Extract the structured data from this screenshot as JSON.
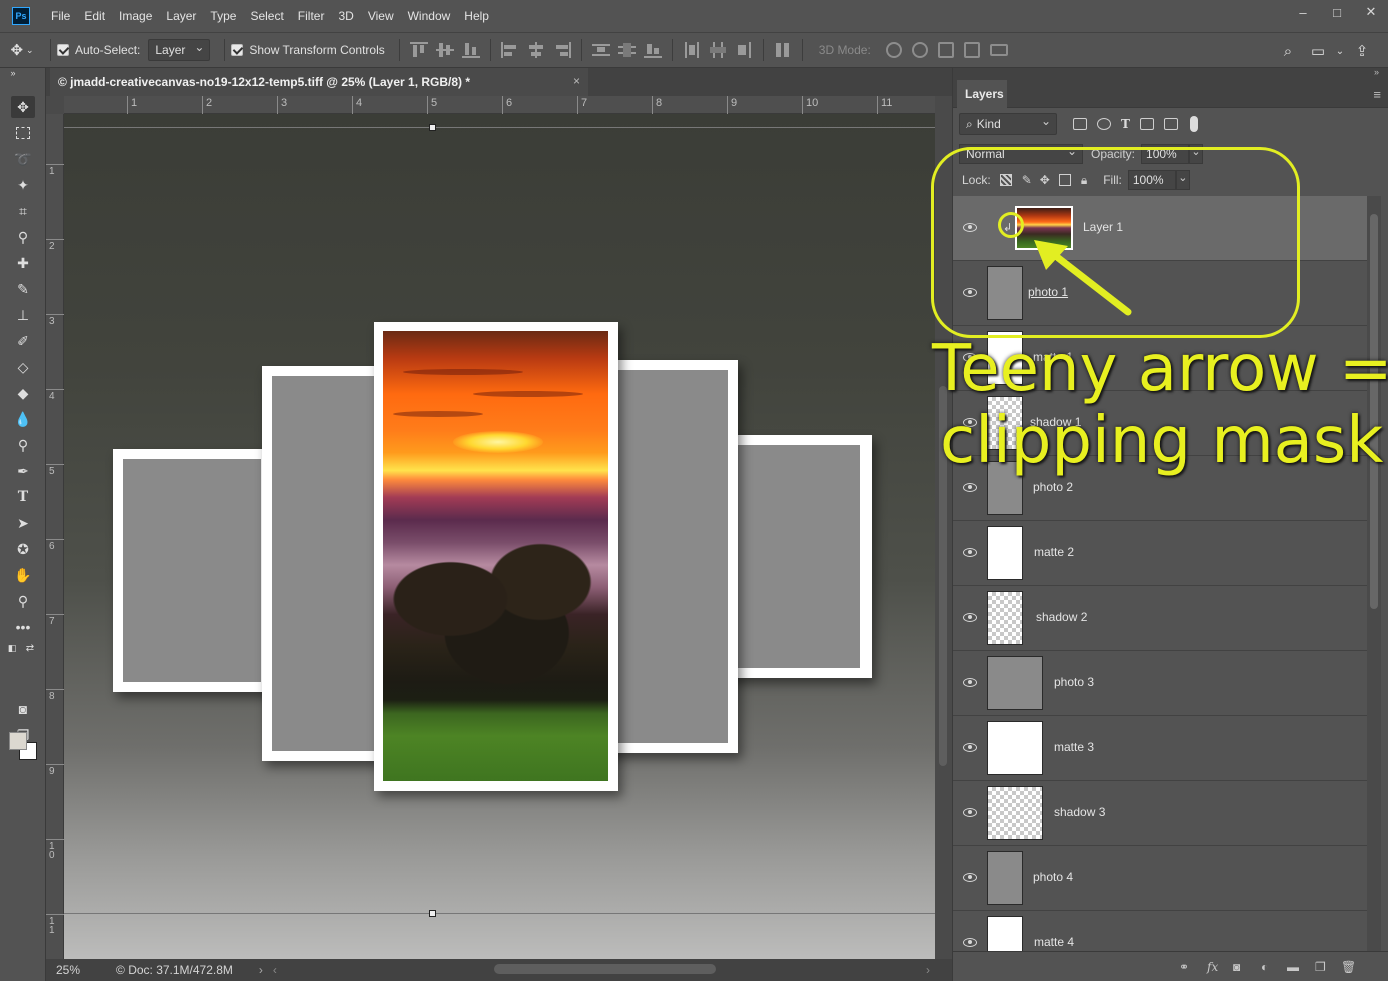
{
  "app": {
    "logo": "Ps"
  },
  "menu": [
    "File",
    "Edit",
    "Image",
    "Layer",
    "Type",
    "Select",
    "Filter",
    "3D",
    "View",
    "Window",
    "Help"
  ],
  "window_controls": {
    "minimize": "–",
    "maximize": "□",
    "close": "✕"
  },
  "options": {
    "auto_select_label": "Auto-Select:",
    "auto_select_value": "Layer",
    "show_transform_label": "Show Transform Controls",
    "mode_label": "3D Mode:"
  },
  "document": {
    "tab_title": "© jmadd-creativecanvas-no19-12x12-temp5.tiff @ 25% (Layer 1, RGB/8) *",
    "close": "×",
    "zoom": "25%",
    "doc_info": "Doc: 37.1M/472.8M"
  },
  "rulers": {
    "h": [
      "1",
      "2",
      "3",
      "4",
      "5",
      "6",
      "7",
      "8",
      "9",
      "10",
      "11"
    ],
    "v": [
      "1",
      "2",
      "3",
      "4",
      "5",
      "6",
      "7",
      "8",
      "9",
      "10",
      "11"
    ]
  },
  "layers_panel": {
    "tab": "Layers",
    "kind": "Kind",
    "blend_mode": "Normal",
    "opacity_label": "Opacity:",
    "opacity_value": "100%",
    "lock_label": "Lock:",
    "fill_label": "Fill:",
    "fill_value": "100%",
    "layers": [
      {
        "name": "Layer 1",
        "thumb": "sunset",
        "selected": true,
        "clipped": true
      },
      {
        "name": "photo 1",
        "thumb": "gray",
        "underline": true
      },
      {
        "name": "matte 1",
        "thumb": "white"
      },
      {
        "name": "shadow 1",
        "thumb": "checker"
      },
      {
        "name": "photo 2",
        "thumb": "gray"
      },
      {
        "name": "matte 2",
        "thumb": "white"
      },
      {
        "name": "shadow 2",
        "thumb": "checker"
      },
      {
        "name": "photo 3",
        "thumb": "gray"
      },
      {
        "name": "matte 3",
        "thumb": "white"
      },
      {
        "name": "shadow 3",
        "thumb": "checker"
      },
      {
        "name": "photo 4",
        "thumb": "gray"
      },
      {
        "name": "matte 4",
        "thumb": "white"
      }
    ]
  },
  "annotation": {
    "line1": "Teeny arrow =",
    "line2": "clipping mask",
    "color": "#e2ee22"
  }
}
